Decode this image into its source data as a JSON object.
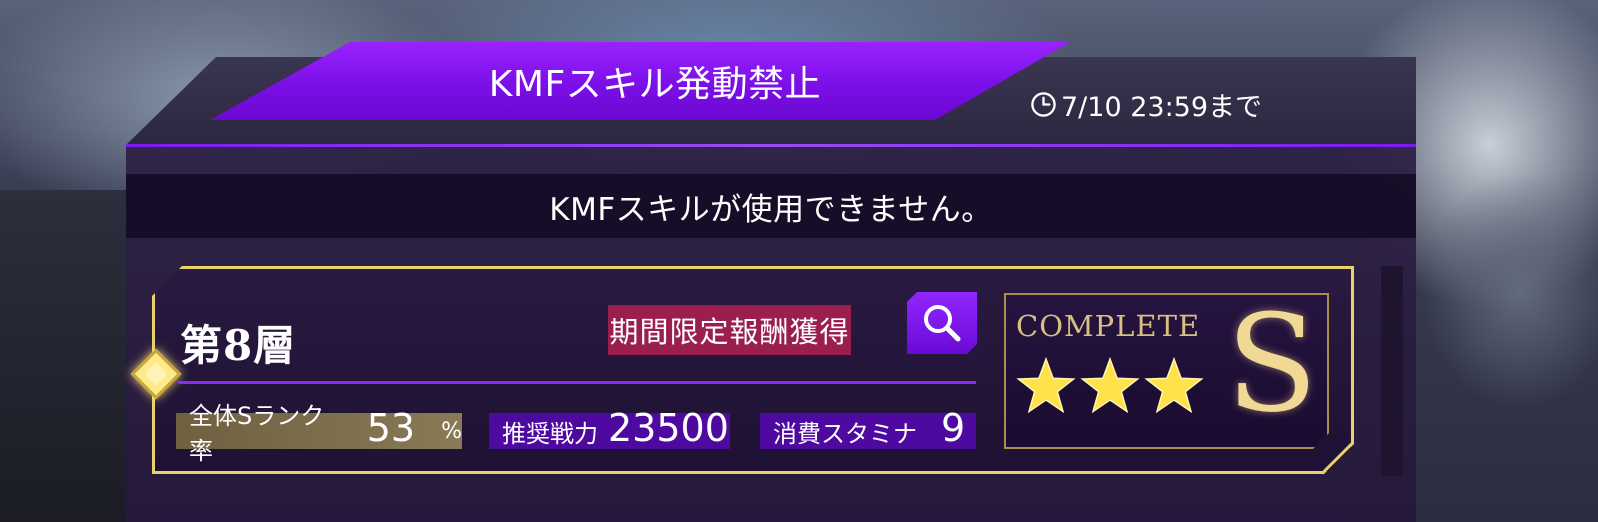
{
  "event": {
    "title": "KMFスキル発動禁止",
    "deadline": "7/10 23:59まで",
    "notice": "KMFスキルが使用できません。"
  },
  "stage": {
    "floor": "第8層",
    "badge": "期間限定報酬獲得",
    "stats": {
      "srank_label": "全体Sランク率",
      "srank_value": "53",
      "srank_unit": "%",
      "power_label": "推奨戦力",
      "power_value": "23500",
      "stamina_label": "消費スタミナ",
      "stamina_value": "9"
    },
    "result": {
      "complete_label": "COMPLETE",
      "stars_earned": 3,
      "stars_total": 3,
      "rank": "S"
    }
  },
  "icons": {
    "search": "search-icon",
    "clock": "clock-icon",
    "star": "star-icon",
    "diamond": "diamond-marker-icon"
  },
  "colors": {
    "accent_purple": "#7b0fe8",
    "gold": "#e8d36a",
    "badge_red": "#9a1f4e",
    "stat_purple": "#4e0aa0"
  }
}
